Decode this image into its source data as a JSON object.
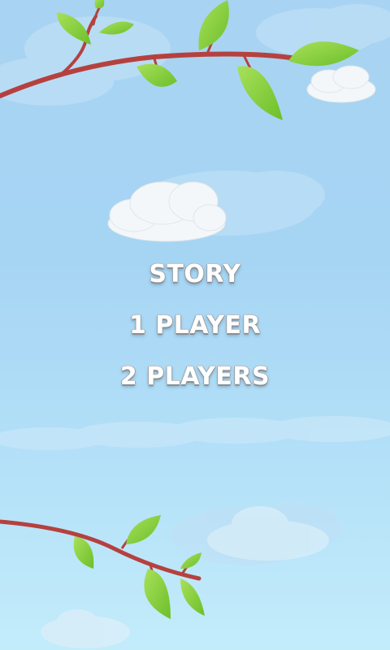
{
  "menu": {
    "items": [
      {
        "label": "STORY"
      },
      {
        "label": "1 PLAYER"
      },
      {
        "label": "2 PLAYERS"
      }
    ]
  },
  "colors": {
    "sky_top": "#a9d3f2",
    "sky_bottom": "#c3ecfb",
    "branch": "#b5413f",
    "leaf": "#8fd33c",
    "cloud": "#f3f6f8",
    "text": "#ffffff"
  }
}
